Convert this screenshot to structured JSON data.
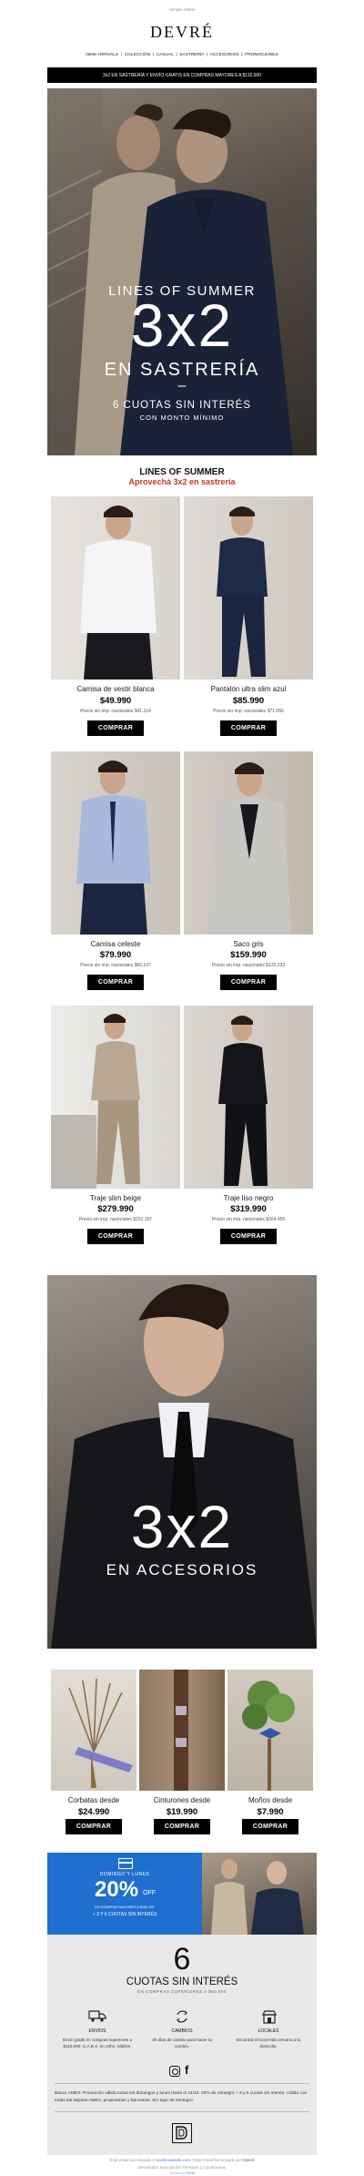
{
  "preheader": "Versión online",
  "brand": "DEVRÉ",
  "nav": [
    "NEW ARRIVALS",
    "COLECCIÓN",
    "CASUAL",
    "SASTRERÍA",
    "ACCESORIOS",
    "PROMOCIONES"
  ],
  "topbar": "3x2 EN SASTRERÍA Y ENVÍO GRATIS EN COMPRAS MAYORES A $115.000",
  "hero": {
    "kicker": "LINES OF SUMMER",
    "big": "3x2",
    "sub": "EN SASTRERÍA",
    "dash": "–",
    "cuotas": "6 CUOTAS SIN INTERÉS",
    "minimo": "CON MONTO MÍNIMO"
  },
  "section": {
    "title": "LINES OF SUMMER",
    "subtitle": "Aprovechá 3x2 en sastrería"
  },
  "products": [
    {
      "name": "Camisa de vestir blanca",
      "price": "$49.990",
      "note": "Precio sin imp. nacionales $41.314",
      "cta": "COMPRAR"
    },
    {
      "name": "Pantalón ultra slim azul",
      "price": "$85.990",
      "note": "Precio sin imp. nacionales $71.066",
      "cta": "COMPRAR"
    },
    {
      "name": "Camisa celeste",
      "price": "$79.990",
      "note": "Precio sin imp. nacionales $66.107",
      "cta": "COMPRAR"
    },
    {
      "name": "Saco gris",
      "price": "$159.990",
      "note": "Precio sin imp. nacionales $132.223",
      "cta": "COMPRAR"
    },
    {
      "name": "Traje slim beige",
      "price": "$279.990",
      "note": "Precio sin imp. nacionales $231.397",
      "cta": "COMPRAR"
    },
    {
      "name": "Traje liso negro",
      "price": "$319.990",
      "note": "Precio sin imp. nacionales $264.455",
      "cta": "COMPRAR"
    }
  ],
  "hero2": {
    "big": "3x2",
    "sub": "EN ACCESORIOS"
  },
  "accessories": [
    {
      "name": "Corbatas desde",
      "price": "$24.990",
      "cta": "COMPRAR"
    },
    {
      "name": "Cinturones desde",
      "price": "$19.990",
      "cta": "COMPRAR"
    },
    {
      "name": "Moños desde",
      "price": "$7.990",
      "cta": "COMPRAR"
    }
  ],
  "promo": {
    "days": "DOMINGO Y LUNES",
    "pct": "20%",
    "off": "OFF",
    "cond": "EN COMPRAS MAYORES A $150.000",
    "plus": "+ 3 Y 6 CUOTAS SIN INTERÉS"
  },
  "cuotas_block": {
    "big": "6",
    "title": "CUOTAS SIN INTERÉS",
    "sub": "EN COMPRAS SUPERIORES A $80.000"
  },
  "services": [
    {
      "title": "ENVÍOS",
      "text": "Envío gratis en compras superiores a $115.000. C.A.B.A. en 24hs. hábiles."
    },
    {
      "title": "CAMBIOS",
      "text": "30 días de cambio para hacer tu cambio."
    },
    {
      "title": "LOCALES",
      "text": "Encontrá el local más cercano a tu domicilio."
    }
  ],
  "legal": "Banco AMEX: Promoción válida todos los domingos y lunes hasta el 31/10. 20% de reintegro + 3 y 6 cuotas sin interés. Válido con todas las tarjetas AMEX, propietarias y bancarias. Sin tope de reintegro.",
  "footer": {
    "line1_pre": "Este email fue enviado a",
    "email": "xxx@example.com",
    "line1_mid": "| Este email fue enviado por",
    "sender": "Devré",
    "line2": "Desuscribir   Suscripción   Términos y Condiciones",
    "verified": "Verified by",
    "verified_brand": "Perfit"
  },
  "colors": {
    "promo_blue": "#1e6fd0",
    "accent_red": "#c0392b",
    "panel_grey": "#e9e9e9"
  }
}
